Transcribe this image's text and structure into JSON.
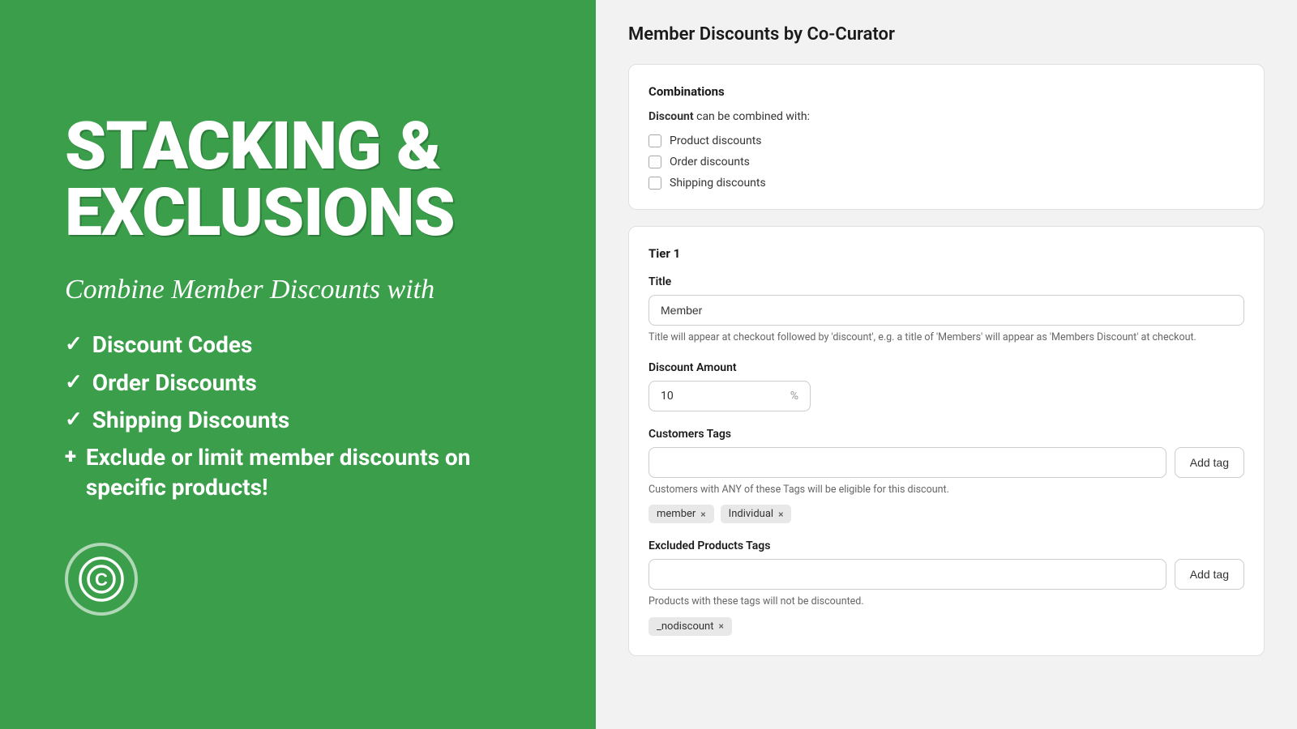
{
  "left": {
    "hero_title": "STACKING &\nEXCLUSIONS",
    "subtitle": "Combine Member Discounts with",
    "features": [
      {
        "type": "check",
        "text": "Discount Codes"
      },
      {
        "type": "check",
        "text": "Order Discounts"
      },
      {
        "type": "check",
        "text": "Shipping Discounts"
      },
      {
        "type": "plus",
        "text": "Exclude or limit member discounts on specific products!"
      }
    ],
    "logo_symbol": "©"
  },
  "right": {
    "app_title": "Member Discounts by Co-Curator",
    "combinations_card": {
      "section_title": "Combinations",
      "discount_label": "Discount",
      "discount_can_be": "can be combined with:",
      "options": [
        {
          "id": "product-discounts",
          "label": "Product discounts"
        },
        {
          "id": "order-discounts",
          "label": "Order discounts"
        },
        {
          "id": "shipping-discounts",
          "label": "Shipping discounts"
        }
      ]
    },
    "tier_card": {
      "tier_title": "Tier 1",
      "title_label": "Title",
      "title_value": "Member",
      "title_hint": "Title will appear at checkout followed by 'discount', e.g. a title of 'Members' will appear as 'Members Discount' at checkout.",
      "discount_amount_label": "Discount Amount",
      "discount_amount_value": "10",
      "discount_amount_suffix": "%",
      "customers_tags_label": "Customers Tags",
      "customers_tags_placeholder": "",
      "add_tag_label": "Add tag",
      "customers_tags_hint": "Customers with ANY of these Tags will be eligible for this discount.",
      "customer_tags": [
        {
          "label": "member"
        },
        {
          "label": "Individual"
        }
      ],
      "excluded_products_label": "Excluded Products Tags",
      "excluded_products_placeholder": "",
      "excluded_products_hint": "Products with these tags will not be discounted.",
      "excluded_tags": [
        {
          "label": "_nodiscount"
        }
      ]
    }
  }
}
